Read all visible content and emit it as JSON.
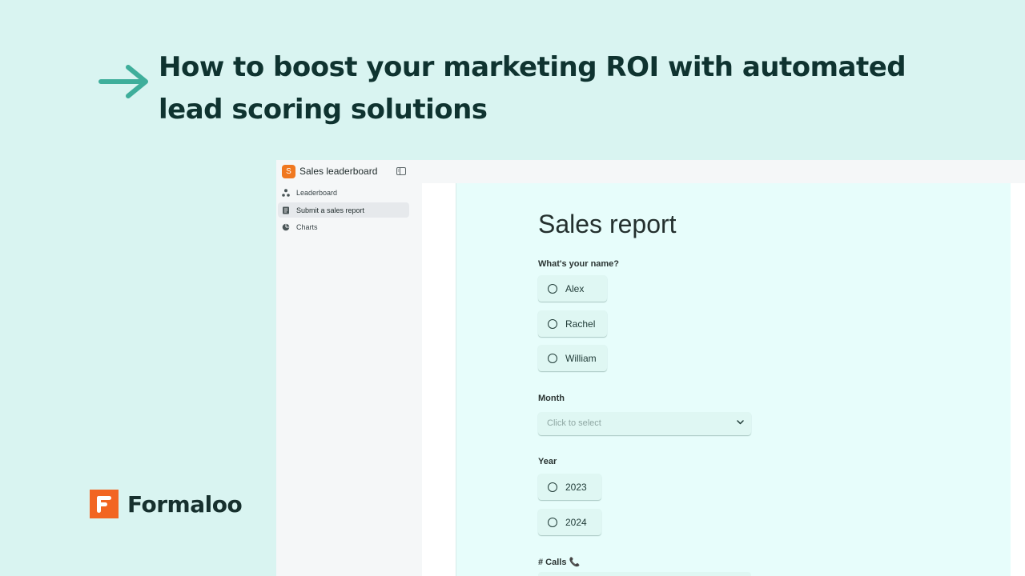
{
  "headline": "How to boost your marketing ROI with automated lead scoring solutions",
  "brand": {
    "name": "Formaloo",
    "color": "#f26522"
  },
  "app": {
    "badge": "S",
    "title": "Sales leaderboard",
    "sidebar": {
      "items": [
        {
          "label": "Leaderboard",
          "icon": "org-chart-icon",
          "active": false
        },
        {
          "label": "Submit a sales report",
          "icon": "form-icon",
          "active": true
        },
        {
          "label": "Charts",
          "icon": "pie-chart-icon",
          "active": false
        }
      ]
    },
    "form": {
      "title": "Sales report",
      "name_question": {
        "label": "What's your name?",
        "options": [
          "Alex",
          "Rachel",
          "William"
        ]
      },
      "month_question": {
        "label": "Month",
        "placeholder": "Click to select"
      },
      "year_question": {
        "label": "Year",
        "options": [
          "2023",
          "2024"
        ]
      },
      "calls_question": {
        "label": "# Calls 📞"
      }
    }
  },
  "colors": {
    "page_background": "#d9f4f1",
    "arrow": "#3fae9b",
    "form_background": "#e7fdfb",
    "badge": "#f07820"
  }
}
